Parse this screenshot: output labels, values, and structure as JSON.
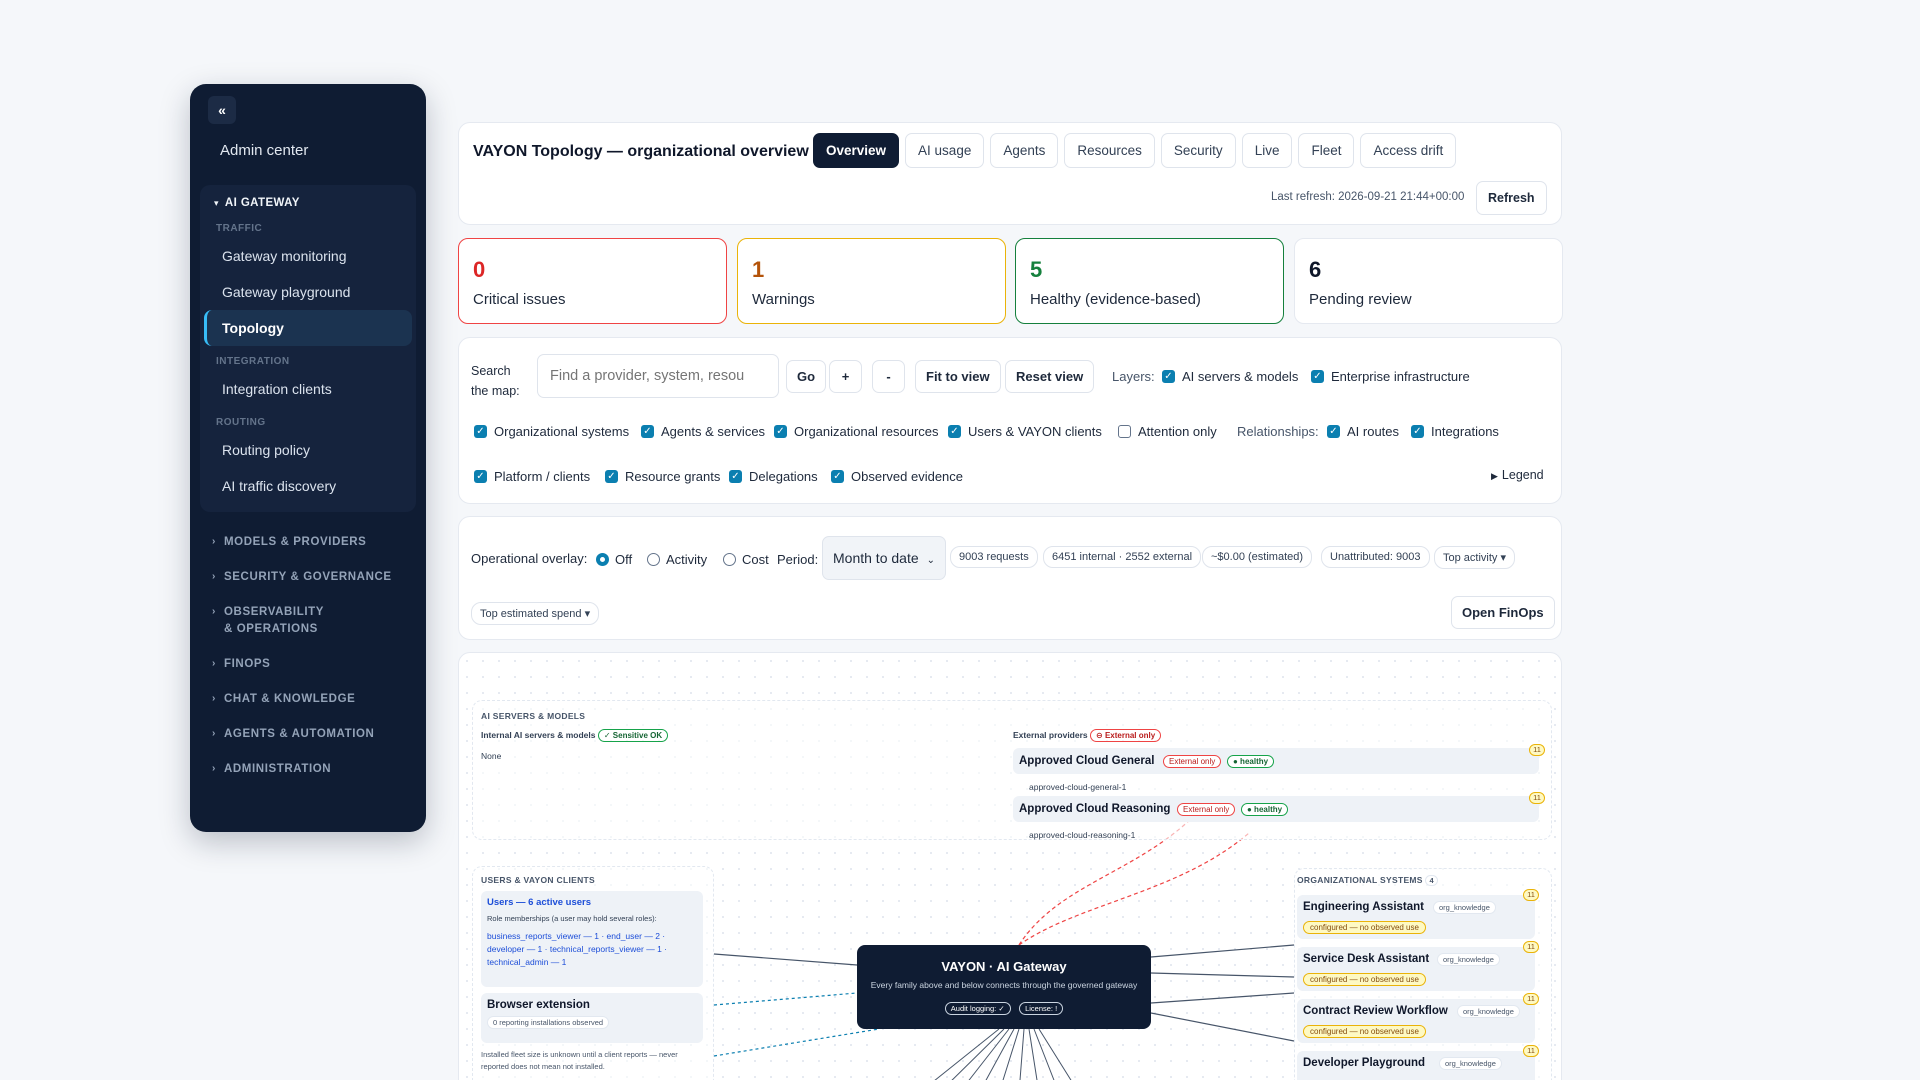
{
  "sidebar": {
    "collapse_icon": "«",
    "admin_title": "Admin center",
    "ai_gateway": {
      "label": "AI GATEWAY",
      "caret": "▾",
      "traffic_label": "TRAFFIC",
      "traffic_items": [
        "Gateway monitoring",
        "Gateway playground",
        "Topology"
      ],
      "integration_label": "INTEGRATION",
      "integration_items": [
        "Integration clients"
      ],
      "routing_label": "ROUTING",
      "routing_items": [
        "Routing policy",
        "AI traffic discovery"
      ]
    },
    "sections": [
      "MODELS & PROVIDERS",
      "SECURITY & GOVERNANCE",
      "OBSERVABILITY & OPERATIONS",
      "FINOPS",
      "CHAT & KNOWLEDGE",
      "AGENTS & AUTOMATION",
      "ADMINISTRATION"
    ]
  },
  "header": {
    "title": "VAYON Topology — organizational overview",
    "tabs": [
      "Overview",
      "AI usage",
      "Agents",
      "Resources",
      "Security",
      "Live",
      "Fleet",
      "Access drift"
    ],
    "last_refresh": "Last refresh: 2026-09-21 21:44+00:00",
    "refresh_label": "Refresh"
  },
  "stats": [
    {
      "value": "0",
      "label": "Critical issues",
      "color": "#dc2626"
    },
    {
      "value": "1",
      "label": "Warnings",
      "color": "#b45309"
    },
    {
      "value": "5",
      "label": "Healthy (evidence-based)",
      "color": "#15803d"
    },
    {
      "value": "6",
      "label": "Pending review",
      "color": "#0f172a"
    }
  ],
  "filters": {
    "search_label": "Search the map:",
    "search_placeholder": "Find a provider, system, resou",
    "go": "Go",
    "zoom_in": "+",
    "zoom_out": "-",
    "fit": "Fit to view",
    "reset": "Reset view",
    "layers_label": "Layers:",
    "layers": [
      "AI servers & models",
      "Enterprise infrastructure",
      "Organizational systems",
      "Agents & services",
      "Organizational resources",
      "Users & VAYON clients"
    ],
    "attention_only": "Attention only",
    "relationships_label": "Relationships:",
    "relationships": [
      "AI routes",
      "Integrations",
      "Platform / clients",
      "Resource grants",
      "Delegations",
      "Observed evidence"
    ],
    "legend": "Legend",
    "check_glyph": "✓"
  },
  "overlay": {
    "label": "Operational overlay:",
    "options": [
      "Off",
      "Activity",
      "Cost"
    ],
    "selected": "Off",
    "period_label": "Period:",
    "period_value": "Month to date",
    "pills": [
      "9003 requests",
      "6451 internal · 2552 external",
      "~$0.00 (estimated)",
      "Unattributed: 9003"
    ],
    "top_activity": "Top activity ▾",
    "top_spend": "Top estimated spend ▾",
    "open_finops": "Open FinOps"
  },
  "map": {
    "ai_servers_title": "AI SERVERS & MODELS",
    "internal_label": "Internal AI servers & models",
    "sensitive_ok": "✓ Sensitive OK",
    "internal_none": "None",
    "external_label": "External providers",
    "external_only": "⊖ External only",
    "providers": [
      {
        "name": "Approved Cloud General",
        "tag": "External only",
        "health": "● healthy",
        "sub": "approved-cloud-general-1",
        "count": "11"
      },
      {
        "name": "Approved Cloud Reasoning",
        "tag": "External only",
        "health": "● healthy",
        "sub": "approved-cloud-reasoning-1",
        "count": "11"
      }
    ],
    "users_title": "USERS & VAYON CLIENTS",
    "users_head": "Users — 6 active users",
    "users_note": "Role memberships (a user may hold several roles):",
    "users_roles": "business_reports_viewer — 1 · end_user — 2 · developer — 1 · technical_reports_viewer — 1 · technical_admin — 1",
    "browser_ext": "Browser extension",
    "browser_pill": "0 reporting installations observed",
    "browser_note": "Installed fleet size is unknown until a client reports — never reported does not mean not installed.",
    "gateway_title": "VAYON · AI Gateway",
    "gateway_sub": "Every family above and below connects through the governed gateway",
    "gateway_audit": "Audit logging: ✓",
    "gateway_license": "License: !",
    "org_title": "ORGANIZATIONAL SYSTEMS",
    "org_count": "4",
    "org_systems": [
      {
        "name": "Engineering Assistant",
        "tag": "org_knowledge",
        "status": "configured — no observed use",
        "count": "11"
      },
      {
        "name": "Service Desk Assistant",
        "tag": "org_knowledge",
        "status": "configured — no observed use",
        "count": "11"
      },
      {
        "name": "Contract Review Workflow",
        "tag": "org_knowledge",
        "status": "configured — no observed use",
        "count": "11"
      },
      {
        "name": "Developer Playground",
        "tag": "org_knowledge",
        "status": "",
        "count": "11"
      }
    ]
  }
}
